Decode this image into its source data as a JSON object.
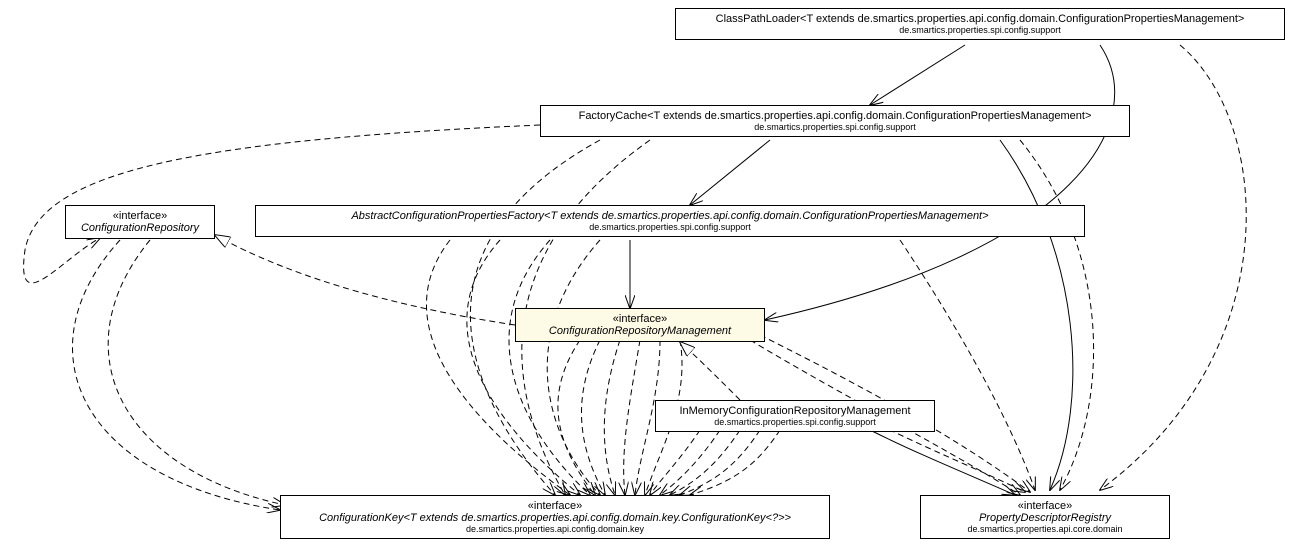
{
  "nodes": {
    "classPathLoader": {
      "name": "ClassPathLoader<T extends de.smartics.properties.api.config.domain.ConfigurationPropertiesManagement>",
      "pkg": "de.smartics.properties.spi.config.support"
    },
    "factoryCache": {
      "name": "FactoryCache<T extends de.smartics.properties.api.config.domain.ConfigurationPropertiesManagement>",
      "pkg": "de.smartics.properties.spi.config.support"
    },
    "configurationRepository": {
      "stereotype": "«interface»",
      "name": "ConfigurationRepository"
    },
    "abstractFactory": {
      "name": "AbstractConfigurationPropertiesFactory<T extends de.smartics.properties.api.config.domain.ConfigurationPropertiesManagement>",
      "pkg": "de.smartics.properties.spi.config.support"
    },
    "configRepoMgmt": {
      "stereotype": "«interface»",
      "name": "ConfigurationRepositoryManagement"
    },
    "inMemory": {
      "name": "InMemoryConfigurationRepositoryManagement",
      "pkg": "de.smartics.properties.spi.config.support"
    },
    "configKey": {
      "stereotype": "«interface»",
      "name": "ConfigurationKey<T extends de.smartics.properties.api.config.domain.key.ConfigurationKey<?>>",
      "pkg": "de.smartics.properties.api.config.domain.key"
    },
    "propDescReg": {
      "stereotype": "«interface»",
      "name": "PropertyDescriptorRegistry",
      "pkg": "de.smartics.properties.api.core.domain"
    }
  }
}
